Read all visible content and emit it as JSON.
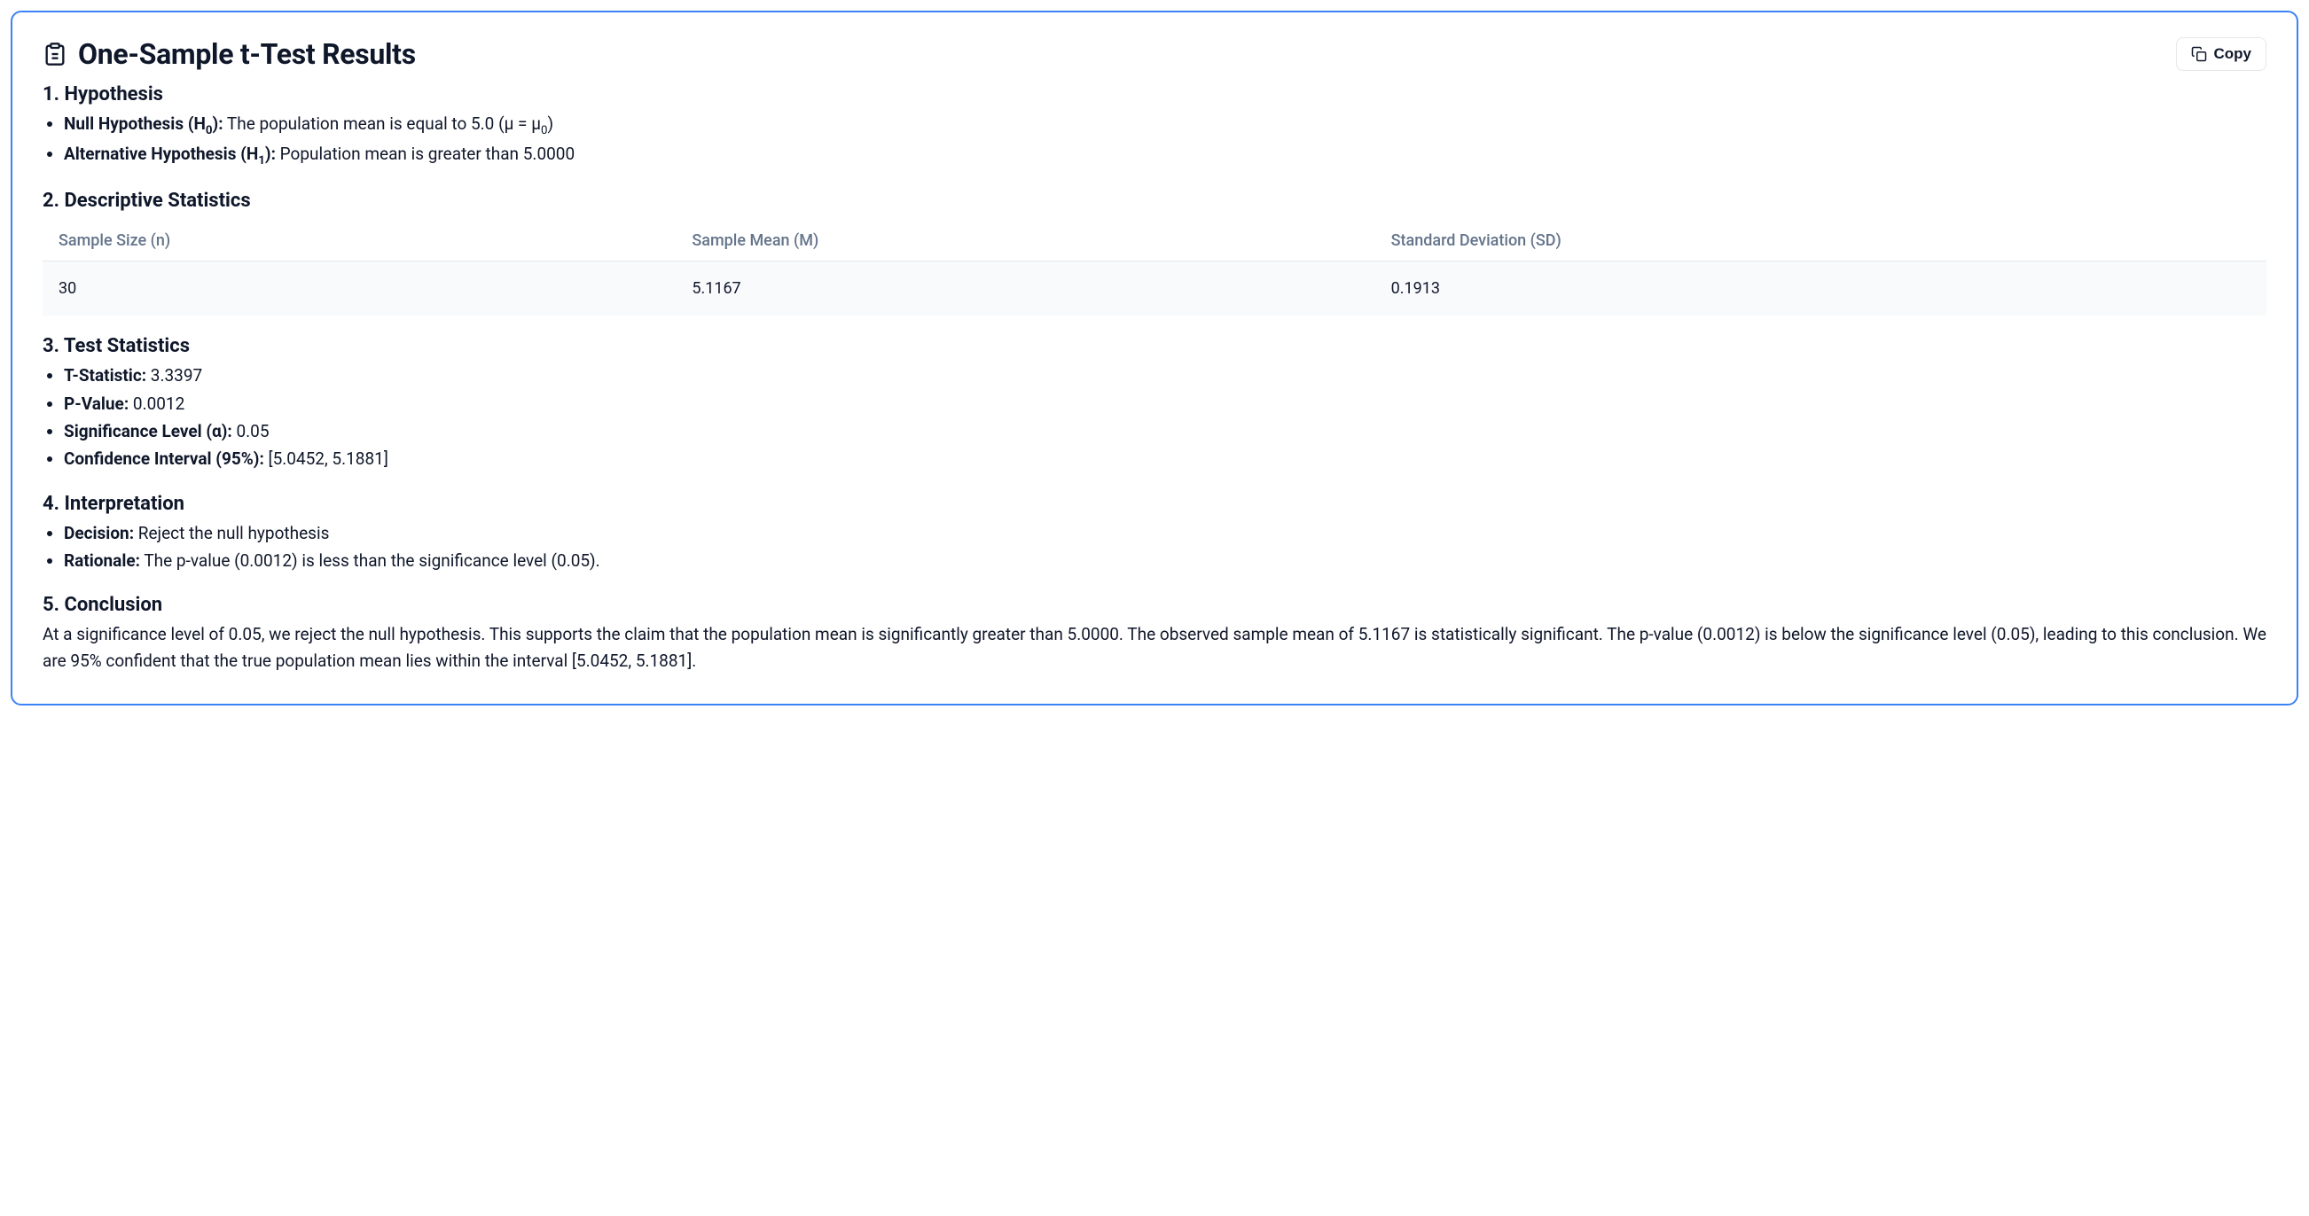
{
  "title": "One-Sample t-Test Results",
  "copy_label": "Copy",
  "sections": {
    "hypothesis": {
      "heading": "1. Hypothesis",
      "null_label": "Null Hypothesis (H",
      "null_sub": "0",
      "null_label_close": "):",
      "null_text": " The population mean is equal to 5.0 (μ = μ",
      "null_text_sub": "0",
      "null_text_close": ")",
      "alt_label": "Alternative Hypothesis (H",
      "alt_sub": "1",
      "alt_label_close": "):",
      "alt_text": " Population mean is greater than 5.0000"
    },
    "descriptive": {
      "heading": "2. Descriptive Statistics",
      "headers": {
        "n": "Sample Size (n)",
        "mean": "Sample Mean (M)",
        "sd": "Standard Deviation (SD)"
      },
      "row": {
        "n": "30",
        "mean": "5.1167",
        "sd": "0.1913"
      }
    },
    "test": {
      "heading": "3. Test Statistics",
      "t_label": "T-Statistic:",
      "t_value": " 3.3397",
      "p_label": "P-Value:",
      "p_value": " 0.0012",
      "alpha_label": "Significance Level (α):",
      "alpha_value": " 0.05",
      "ci_label": "Confidence Interval (95%):",
      "ci_value": " [5.0452, 5.1881]"
    },
    "interpretation": {
      "heading": "4. Interpretation",
      "decision_label": "Decision:",
      "decision_value": " Reject the null hypothesis",
      "rationale_label": "Rationale:",
      "rationale_value": " The p-value (0.0012) is less than the significance level (0.05)."
    },
    "conclusion": {
      "heading": "5. Conclusion",
      "text": "At a significance level of 0.05, we reject the null hypothesis. This supports the claim that the population mean is significantly greater than 5.0000. The observed sample mean of 5.1167 is statistically significant. The p-value (0.0012) is below the significance level (0.05), leading to this conclusion. We are 95% confident that the true population mean lies within the interval [5.0452, 5.1881]."
    }
  }
}
